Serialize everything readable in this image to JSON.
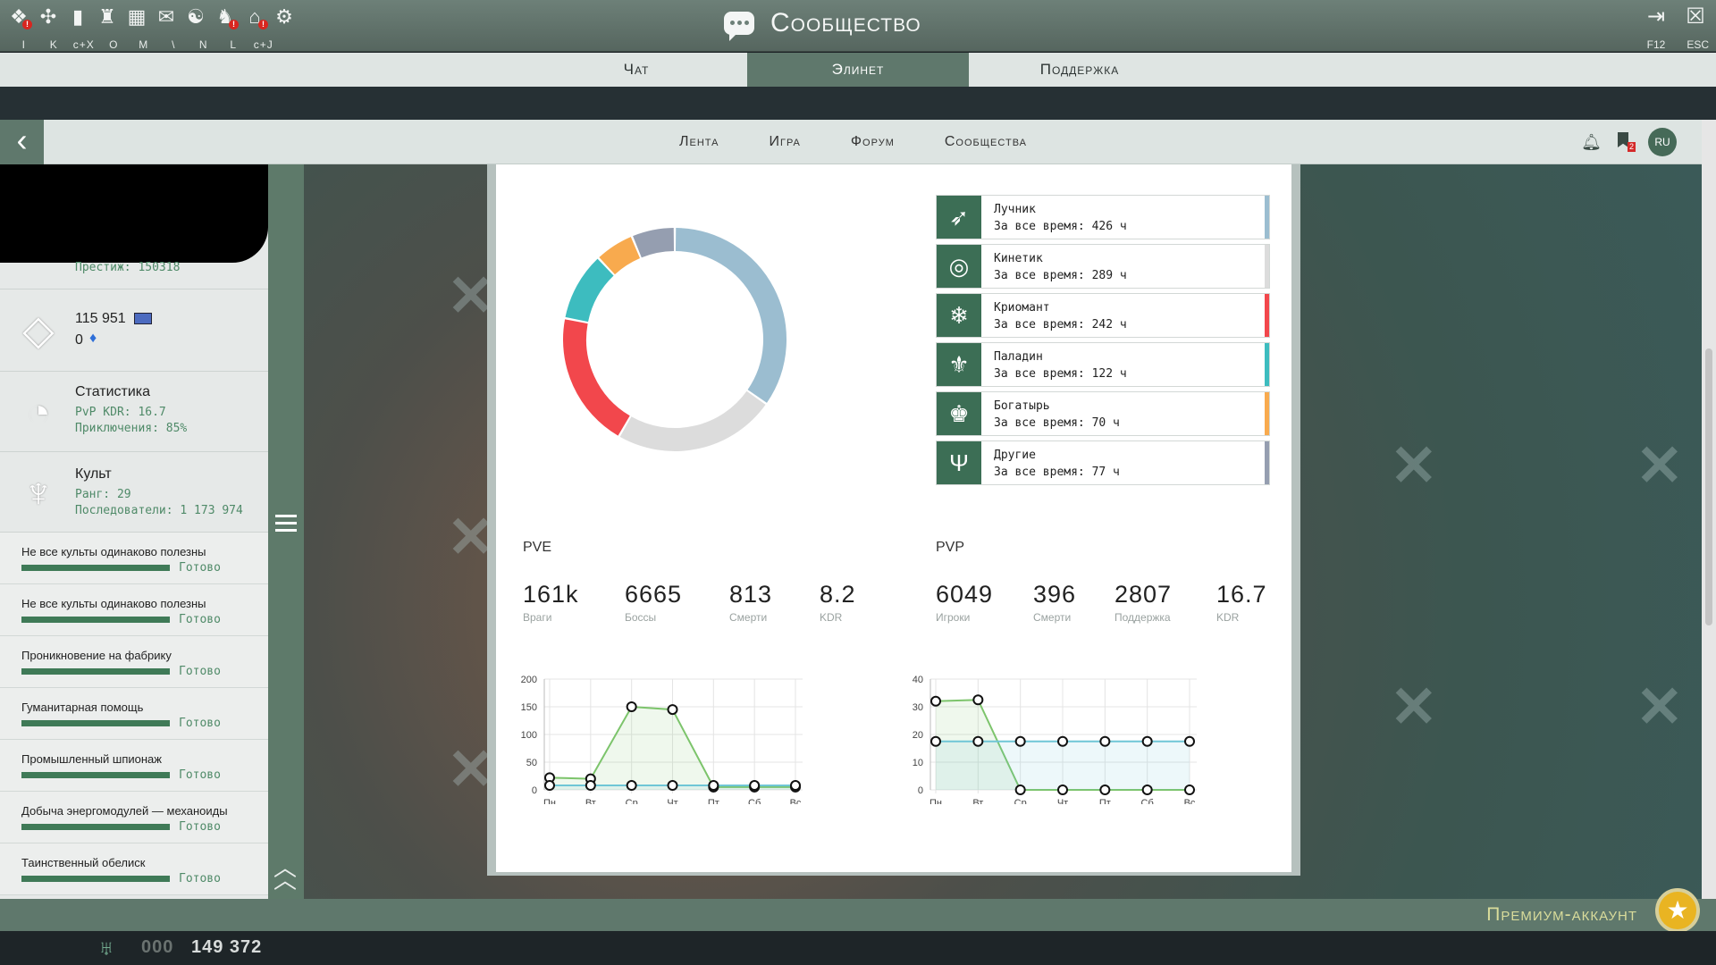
{
  "topbar": {
    "title": "Сообщество",
    "hotkeys": [
      "I",
      "K",
      "c+X",
      "O",
      "M",
      "\\",
      "N",
      "L",
      "c+J"
    ],
    "right_keys": [
      "F12",
      "ESC"
    ]
  },
  "main_tabs": [
    {
      "label": "Чат"
    },
    {
      "label": "Элинет"
    },
    {
      "label": "Поддержка"
    }
  ],
  "web_nav": [
    {
      "label": "Лента"
    },
    {
      "label": "Игра"
    },
    {
      "label": "Форум"
    },
    {
      "label": "Сообщества"
    }
  ],
  "web_header": {
    "bookmark_badge": "2",
    "lang": "RU"
  },
  "profile": {
    "prestige": "Престиж: 150318",
    "currency1": "115 951",
    "currency2": "0",
    "stats_title": "Статистика",
    "stats_kdr": "PvP KDR: 16.7",
    "stats_adv": "Приключения: 85%",
    "cult_title": "Культ",
    "cult_rank": "Ранг: 29",
    "cult_followers": "Последователи: 1 173 974"
  },
  "quests": [
    {
      "name": "Не все культы одинаково полезны",
      "status": "Готово"
    },
    {
      "name": "Не все культы одинаково полезны",
      "status": "Готово"
    },
    {
      "name": "Проникновение на фабрику",
      "status": "Готово"
    },
    {
      "name": "Гуманитарная помощь",
      "status": "Готово"
    },
    {
      "name": "Промышленный шпионаж",
      "status": "Готово"
    },
    {
      "name": "Добыча энергомодулей — механоиды",
      "status": "Готово"
    },
    {
      "name": "Таинственный обелиск",
      "status": "Готово"
    }
  ],
  "classes": [
    {
      "name": "Лучник",
      "time": "За все время: 426 ч",
      "hours": 426,
      "color": "#9bbdd0",
      "icon": "bow-icon"
    },
    {
      "name": "Кинетик",
      "time": "За все время: 289 ч",
      "hours": 289,
      "color": "#dcdcdc",
      "icon": "kinetic-icon"
    },
    {
      "name": "Криомант",
      "time": "За все время: 242 ч",
      "hours": 242,
      "color": "#f2474c",
      "icon": "snowflake-icon"
    },
    {
      "name": "Паладин",
      "time": "За все время: 122 ч",
      "hours": 122,
      "color": "#3dbcbf",
      "icon": "paladin-icon"
    },
    {
      "name": "Богатырь",
      "time": "За все время: 70 ч",
      "hours": 70,
      "color": "#f8aa4e",
      "icon": "eagle-icon"
    },
    {
      "name": "Другие",
      "time": "За все время: 77 ч",
      "hours": 77,
      "color": "#959eb0",
      "icon": "other-icon"
    }
  ],
  "pve": {
    "title": "PVE",
    "stats": [
      {
        "value": "161k",
        "label": "Враги"
      },
      {
        "value": "6665",
        "label": "Боссы"
      },
      {
        "value": "813",
        "label": "Смерти"
      },
      {
        "value": "8.2",
        "label": "KDR"
      }
    ]
  },
  "pvp": {
    "title": "PVP",
    "stats": [
      {
        "value": "6049",
        "label": "Игроки"
      },
      {
        "value": "396",
        "label": "Смерти"
      },
      {
        "value": "2807",
        "label": "Поддержка"
      },
      {
        "value": "16.7",
        "label": "KDR"
      }
    ]
  },
  "chart_data": [
    {
      "type": "pie",
      "categories": [
        "Лучник",
        "Кинетик",
        "Криомант",
        "Паладин",
        "Богатырь",
        "Другие"
      ],
      "values": [
        426,
        289,
        242,
        122,
        70,
        77
      ],
      "colors": [
        "#9bbdd0",
        "#dcdcdc",
        "#f2474c",
        "#3dbcbf",
        "#f8aa4e",
        "#959eb0"
      ]
    },
    {
      "type": "line",
      "categories": [
        "Пн",
        "Вт",
        "Ср",
        "Чт",
        "Пт",
        "Сб",
        "Вс"
      ],
      "ylim": [
        0,
        200
      ],
      "yticks": [
        0,
        50,
        100,
        150,
        200
      ],
      "series": [
        {
          "values": [
            22,
            20,
            150,
            145,
            5,
            5,
            5
          ],
          "color": "#7cc46b"
        },
        {
          "values": [
            8,
            8,
            8,
            8,
            8,
            8,
            8
          ],
          "color": "#6fc6d6"
        }
      ]
    },
    {
      "type": "line",
      "categories": [
        "Пн",
        "Вт",
        "Ср",
        "Чт",
        "Пт",
        "Сб",
        "Вс"
      ],
      "ylim": [
        0,
        40
      ],
      "yticks": [
        0,
        10,
        20,
        30,
        40
      ],
      "series": [
        {
          "values": [
            32,
            32.5,
            0,
            0,
            0,
            0,
            0
          ],
          "color": "#7cc46b"
        },
        {
          "values": [
            17.5,
            17.5,
            17.5,
            17.5,
            17.5,
            17.5,
            17.5
          ],
          "color": "#6fc6d6"
        }
      ]
    }
  ]
}
